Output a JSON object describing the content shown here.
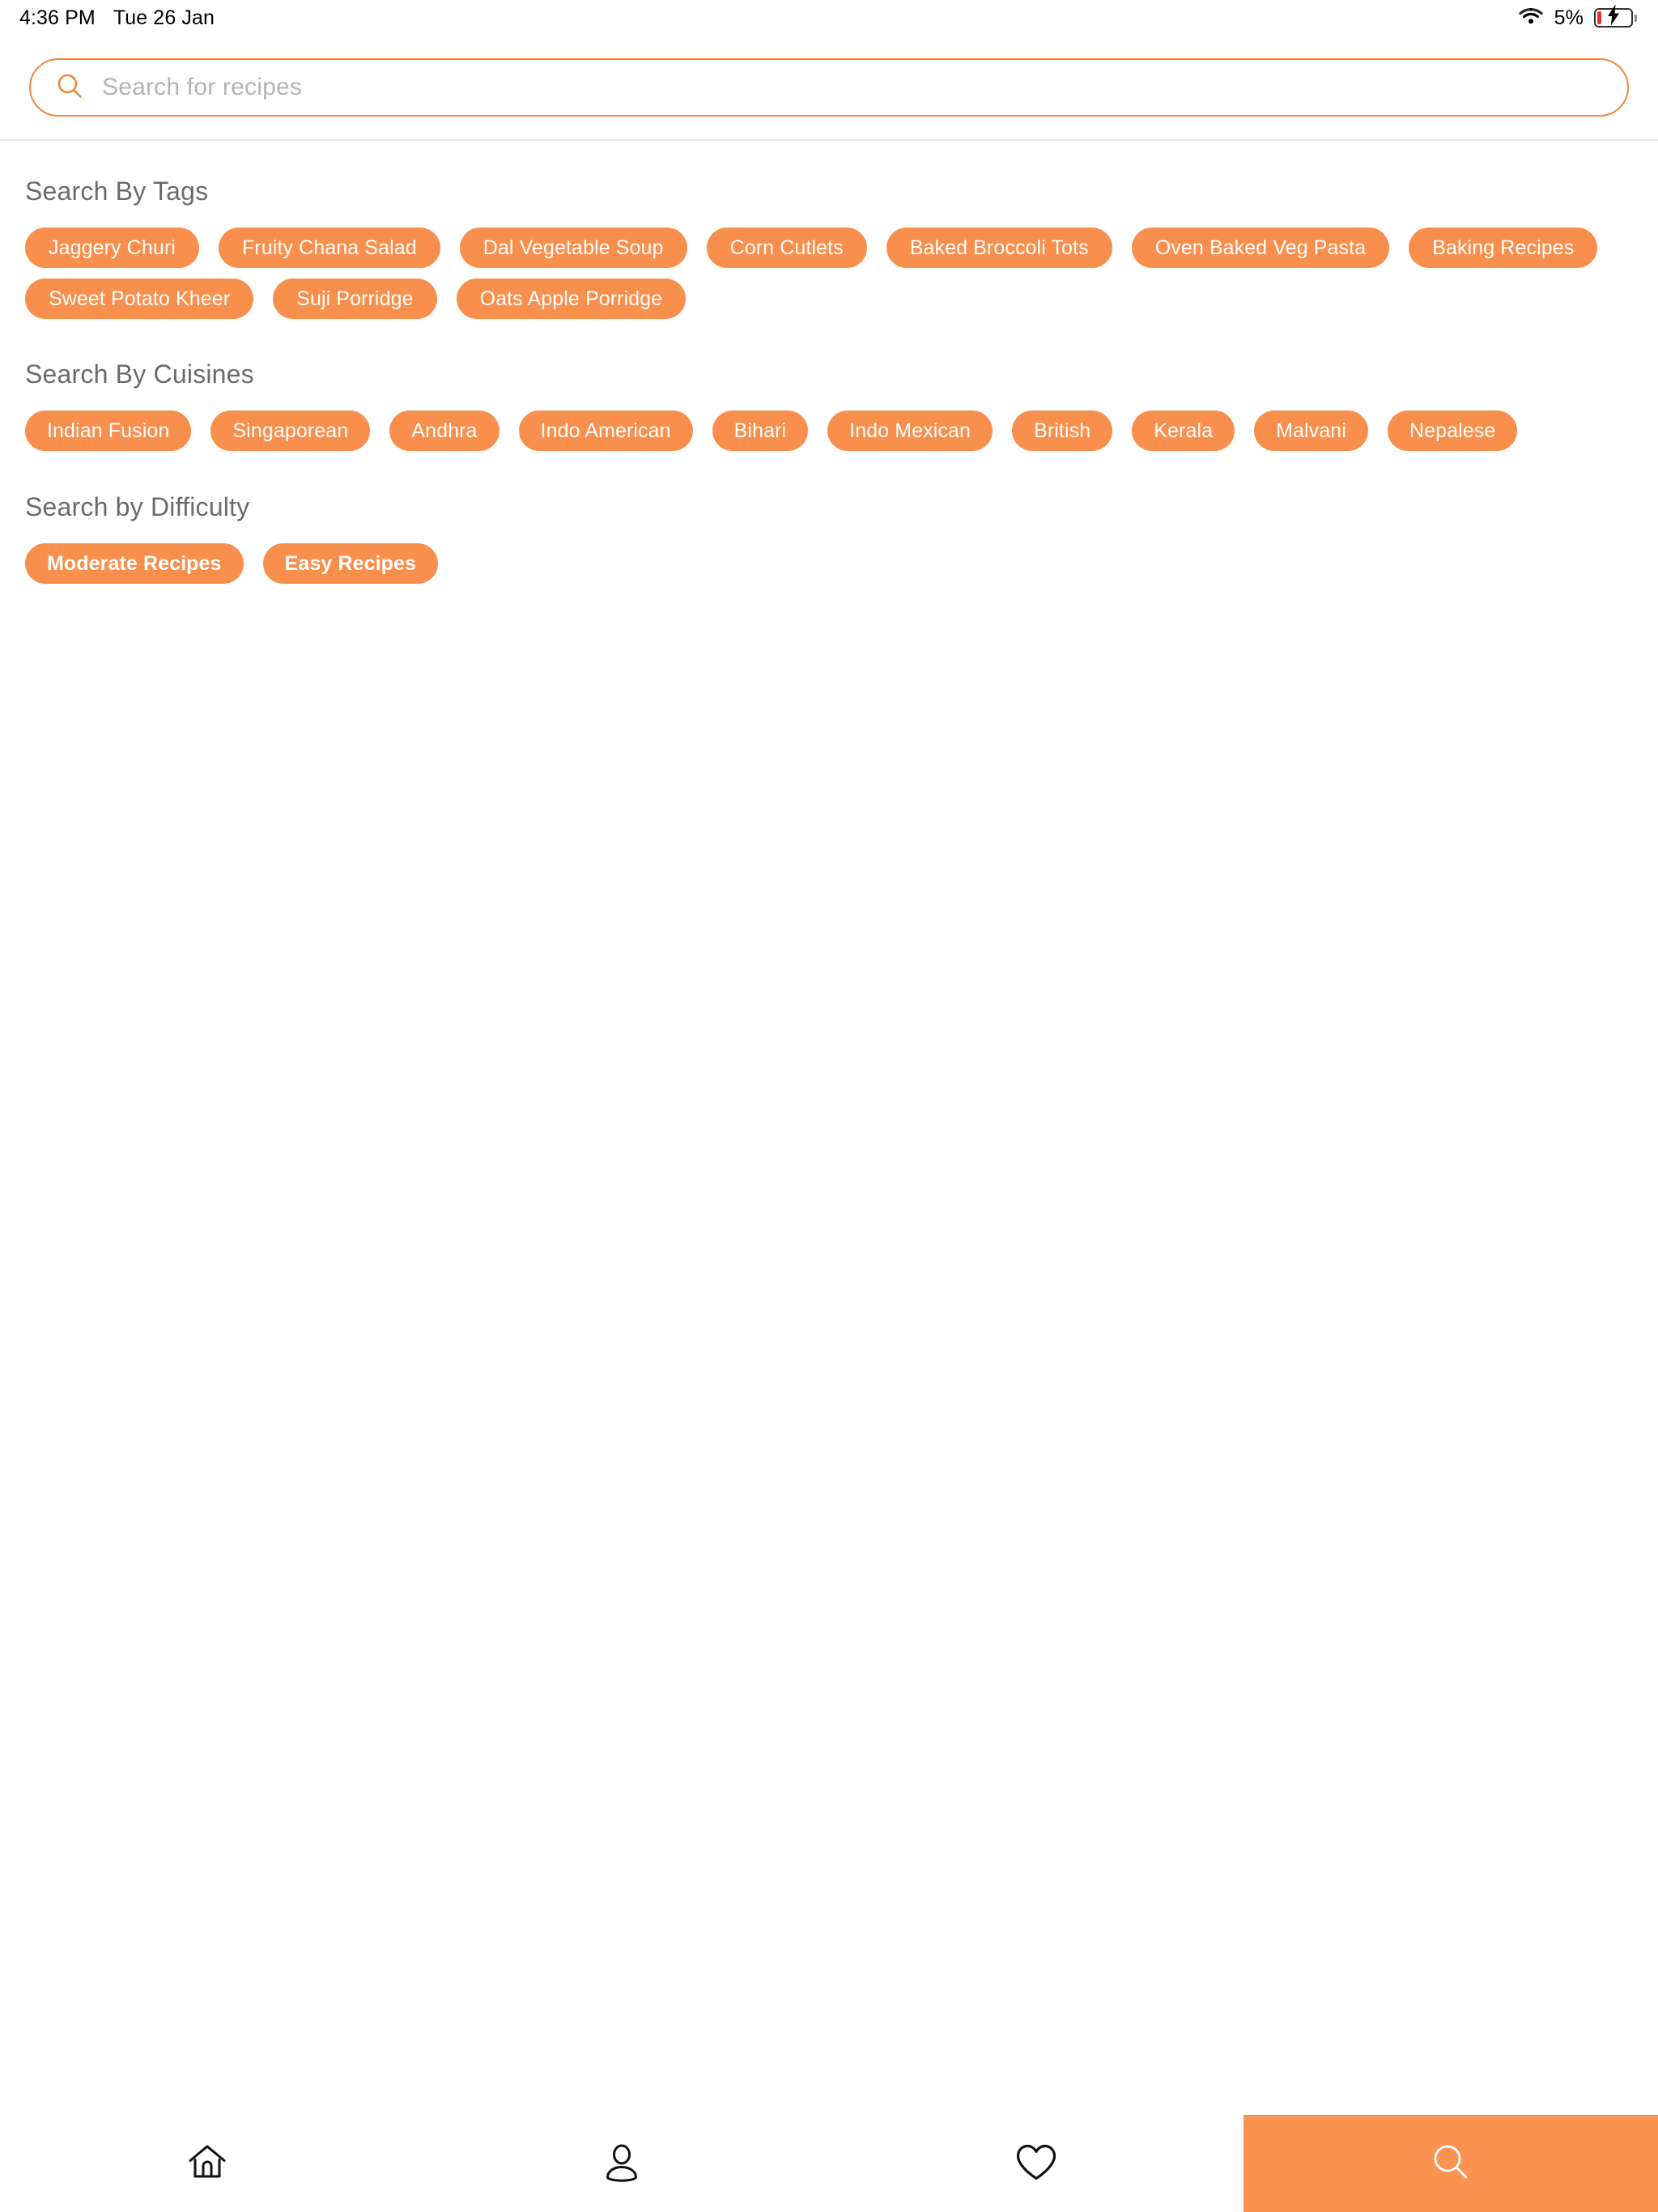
{
  "status_bar": {
    "time": "4:36 PM",
    "date": "Tue 26 Jan",
    "battery_percent": "5%",
    "wifi_icon": "wifi-icon",
    "battery_icon": "battery-charging-icon"
  },
  "search": {
    "placeholder": "Search for recipes",
    "value": "",
    "icon": "search-icon",
    "accent_color": "#f0883e"
  },
  "theme": {
    "chip_color": "#f98f4d",
    "active_nav_color": "#fc9350",
    "heading_color": "#6b6b6b",
    "placeholder_color": "#b4b4b4"
  },
  "sections": [
    {
      "id": "tags",
      "title": "Search By Tags",
      "chips": [
        "Jaggery Churi",
        "Fruity Chana Salad",
        "Dal Vegetable Soup",
        "Corn Cutlets",
        "Baked Broccoli Tots",
        "Oven Baked Veg Pasta",
        "Baking Recipes",
        "Sweet Potato Kheer",
        "Suji Porridge",
        "Oats Apple Porridge"
      ]
    },
    {
      "id": "cuisines",
      "title": "Search By Cuisines",
      "chips": [
        "Indian Fusion",
        "Singaporean",
        "Andhra",
        "Indo American",
        "Bihari",
        "Indo Mexican",
        "British",
        "Kerala",
        "Malvani",
        "Nepalese"
      ]
    },
    {
      "id": "difficulty",
      "title": "Search by Difficulty",
      "chips": [
        "Moderate Recipes",
        "Easy Recipes"
      ]
    }
  ],
  "bottom_nav": {
    "items": [
      {
        "id": "home",
        "icon": "home-icon",
        "active": false
      },
      {
        "id": "profile",
        "icon": "person-icon",
        "active": false
      },
      {
        "id": "favourites",
        "icon": "heart-icon",
        "active": false
      },
      {
        "id": "search",
        "icon": "search-icon",
        "active": true
      }
    ]
  }
}
